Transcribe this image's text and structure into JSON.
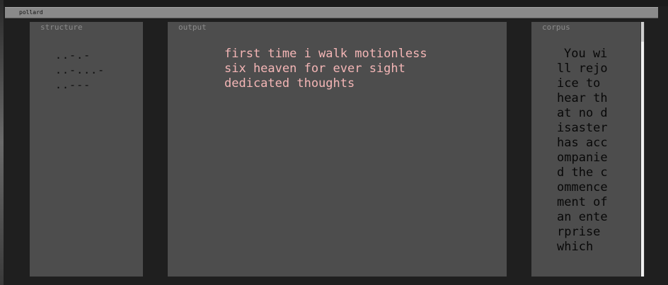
{
  "window": {
    "title": "pollard"
  },
  "panels": {
    "structure": {
      "label": "structure",
      "lines": [
        "..-.-",
        "..-...-",
        "..---"
      ]
    },
    "output": {
      "label": "output",
      "lines": [
        "first time i walk motionless",
        "six heaven for ever sight",
        "dedicated thoughts"
      ]
    },
    "corpus": {
      "label": "corpus",
      "text": "You will rejoice to hear that no disaster has accompanied the commencement of an enterprise which"
    }
  },
  "colors": {
    "background": "#1f1f1f",
    "panel": "#4d4d4d",
    "output_text": "#f4b6b6",
    "label_text": "#8b8b8b",
    "titlebar": "#8a8a8a"
  }
}
